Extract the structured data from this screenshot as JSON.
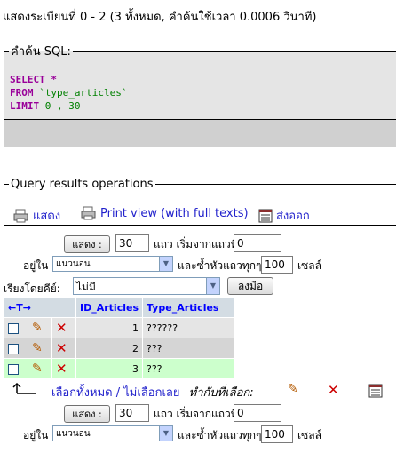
{
  "status_text": "แสดงระเบียนที่ 0 - 2 (3 ทั้งหมด, คำค้นใช้เวลา 0.0006 วินาที)",
  "sql_box": {
    "legend": "คำค้น SQL:",
    "select_kw": "SELECT",
    "select_rest": " *",
    "from_kw": "FROM",
    "from_table": "`type_articles`",
    "limit_kw": "LIMIT",
    "limit_values": "0 , 30"
  },
  "ops": {
    "legend": "Query results operations",
    "show_label": "แสดง",
    "print_label": "Print view (with full texts)",
    "export_label": "ส่งออก"
  },
  "nav_top": {
    "show_button": "แสดง :",
    "rows_value": "30",
    "start_label": "แถว เริ่มจากแถวที่",
    "start_value": "0",
    "in_label": "อยู่ใน",
    "mode_select": "แนวนอน",
    "repeat_label": "และซ้ำหัวแถวทุกๆ",
    "repeat_value": "100",
    "cells_label": "เซลล์"
  },
  "sort": {
    "label": "เรียงโดยคีย์:",
    "select_value": "ไม่มี",
    "go_button": "ลงมือ"
  },
  "table": {
    "sort_arrows": "←T→",
    "columns": [
      "ID_Articles",
      "Type_Articles"
    ],
    "rows": [
      {
        "id": "1",
        "type": "??????"
      },
      {
        "id": "2",
        "type": "???"
      },
      {
        "id": "3",
        "type": "???"
      }
    ]
  },
  "bulk": {
    "select_all": "เลือกทั้งหมด",
    "separator": " / ",
    "deselect_all": "ไม่เลือกเลย",
    "with_selected": "ทำกับที่เลือก:"
  },
  "nav_bottom": {
    "show_button": "แสดง :",
    "rows_value": "30",
    "start_label": "แถว เริ่มจากแถวที่",
    "start_value": "0",
    "in_label": "อยู่ใน",
    "mode_select": "แนวนอน",
    "repeat_label": "และซ้ำหัวแถวทุกๆ",
    "repeat_value": "100",
    "cells_label": "เซลล์"
  }
}
